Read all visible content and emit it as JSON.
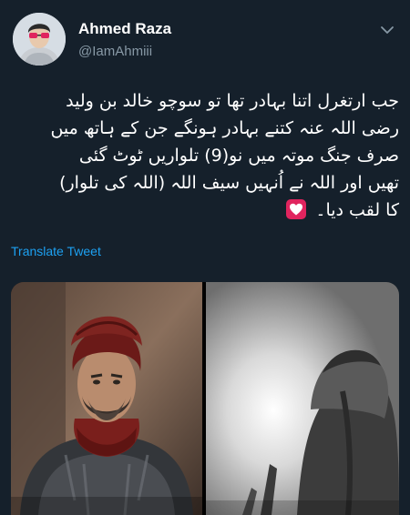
{
  "tweet": {
    "author_name": "Ahmed Raza",
    "author_handle": "@IamAhmiii",
    "lines": [
      "جب ارتغرل اتنا بہادر تھا تو سوچو خالد بن ولید",
      "رضی اللہ عنہ کتنے بہادر ہونگے جن کے ہاتھ میں",
      "صرف جنگ موتہ میں نو(9) تلواریں ٹوٹ گئی",
      "تھیں اور اللہ نے اُنہیں سیف اللہ (اللہ کی تلوار)",
      "کا لقب دیا۔"
    ],
    "translate_label": "Translate Tweet",
    "icons": {
      "menu": "chevron-down-icon",
      "emoji": "white-heart-emoji"
    },
    "colors": {
      "background": "#15202b",
      "link": "#1da1f2",
      "secondary_text": "#8899a6",
      "heart_bg": "#e0245e"
    }
  }
}
